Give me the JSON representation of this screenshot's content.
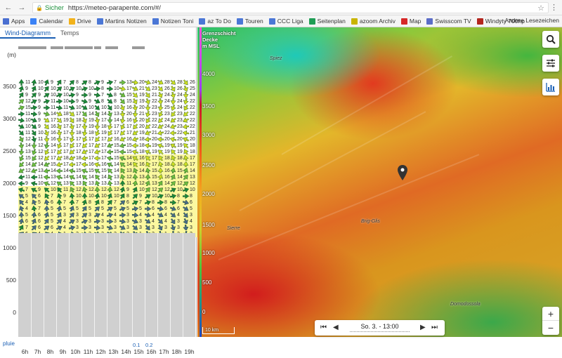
{
  "browser": {
    "secure_label": "Sicher",
    "url": "https://meteo-parapente.com/#/"
  },
  "bookmarks": [
    {
      "label": "Apps",
      "icon": "apps-grid-icon",
      "color": "#4a6fd1"
    },
    {
      "label": "Calendar",
      "icon": "calendar-icon",
      "color": "#3b82f6"
    },
    {
      "label": "Drive",
      "icon": "drive-icon",
      "color": "#f2b21b"
    },
    {
      "label": "Martins Notizen",
      "icon": "doc-icon",
      "color": "#4b77d6"
    },
    {
      "label": "Notizen Toni",
      "icon": "doc-icon",
      "color": "#4b77d6"
    },
    {
      "label": "az To Do",
      "icon": "doc-icon",
      "color": "#4b77d6"
    },
    {
      "label": "Touren",
      "icon": "doc-icon",
      "color": "#4b77d6"
    },
    {
      "label": "CCC Liga",
      "icon": "doc-icon",
      "color": "#4b77d6"
    },
    {
      "label": "Seitenplan",
      "icon": "sheet-icon",
      "color": "#1f9d55"
    },
    {
      "label": "azoom Archiv",
      "icon": "a2-icon",
      "color": "#c9b400"
    },
    {
      "label": "Map",
      "icon": "swiss-icon",
      "color": "#d62828"
    },
    {
      "label": "Swisscom TV",
      "icon": "swisscom-icon",
      "color": "#5b6dc8"
    },
    {
      "label": "Windyty 700hp",
      "icon": "windyty-icon",
      "color": "#b3261e"
    }
  ],
  "bookmarks_more": "Andere Lesezeichen",
  "tabs": [
    {
      "label": "Wind-Diagramm",
      "active": true
    },
    {
      "label": "Temps",
      "active": false
    }
  ],
  "diagram": {
    "unit": "(m)",
    "y_labels": [
      "3500",
      "3000",
      "2500",
      "2000",
      "1500",
      "1000",
      "500",
      "0"
    ],
    "hours": [
      "6h",
      "7h",
      "8h",
      "9h",
      "10h",
      "11h",
      "12h",
      "13h",
      "14h",
      "15h",
      "16h",
      "17h",
      "18h",
      "19h"
    ],
    "rain_label": "pluie",
    "rain": [
      {
        "hour_index": 9,
        "value": "0.1"
      },
      {
        "hour_index": 10,
        "value": "0.2"
      }
    ],
    "rows": [
      [
        "11",
        "10",
        "9",
        "7",
        "8",
        "8",
        "9",
        "7",
        "13",
        "20",
        "24",
        "28",
        "28",
        "26"
      ],
      [
        "9",
        "10",
        "10",
        "10",
        "10",
        "10",
        "8",
        "10",
        "17",
        "21",
        "23",
        "26",
        "26",
        "25"
      ],
      [
        "9",
        "9",
        "10",
        "10",
        "9",
        "9",
        "7",
        "8",
        "15",
        "19",
        "21",
        "24",
        "24",
        "24"
      ],
      [
        "12",
        "9",
        "11",
        "10",
        "9",
        "9",
        "8",
        "8",
        "15",
        "19",
        "22",
        "24",
        "24",
        "22"
      ],
      [
        "15",
        "9",
        "11",
        "11",
        "10",
        "10",
        "10",
        "10",
        "16",
        "20",
        "23",
        "25",
        "24",
        "22"
      ],
      [
        "11",
        "9",
        "14",
        "18",
        "17",
        "14",
        "14",
        "13",
        "20",
        "21",
        "23",
        "23",
        "23",
        "22"
      ],
      [
        "10",
        "9",
        "17",
        "19",
        "18",
        "19",
        "17",
        "14",
        "16",
        "20",
        "22",
        "24",
        "23",
        "22"
      ],
      [
        "10",
        "9",
        "16",
        "17",
        "17",
        "19",
        "18",
        "17",
        "17",
        "20",
        "22",
        "24",
        "23",
        "22"
      ],
      [
        "11",
        "10",
        "16",
        "17",
        "18",
        "18",
        "19",
        "17",
        "17",
        "19",
        "21",
        "22",
        "22",
        "21"
      ],
      [
        "12",
        "11",
        "16",
        "17",
        "17",
        "17",
        "17",
        "16",
        "16",
        "18",
        "20",
        "20",
        "20",
        "20"
      ],
      [
        "14",
        "12",
        "14",
        "17",
        "17",
        "17",
        "17",
        "15",
        "15",
        "18",
        "19",
        "19",
        "19",
        "18"
      ],
      [
        "13",
        "12",
        "17",
        "17",
        "17",
        "17",
        "17",
        "15",
        "15",
        "18",
        "19",
        "19",
        "19",
        "18"
      ],
      [
        "15",
        "12",
        "17",
        "18",
        "18",
        "17",
        "17",
        "15",
        "14",
        "16",
        "17",
        "18",
        "18",
        "17"
      ],
      [
        "14",
        "14",
        "15",
        "17",
        "17",
        "16",
        "16",
        "14",
        "14",
        "16",
        "17",
        "18",
        "18",
        "17"
      ],
      [
        "12",
        "13",
        "14",
        "14",
        "15",
        "15",
        "15",
        "14",
        "13",
        "14",
        "15",
        "16",
        "15",
        "14"
      ],
      [
        "11",
        "11",
        "13",
        "14",
        "14",
        "14",
        "14",
        "13",
        "12",
        "13",
        "15",
        "16",
        "14",
        "13"
      ],
      [
        "9",
        "10",
        "12",
        "13",
        "13",
        "13",
        "13",
        "13",
        "11",
        "12",
        "13",
        "14",
        "12",
        "12"
      ],
      [
        "7",
        "9",
        "10",
        "11",
        "12",
        "12",
        "12",
        "12",
        "9",
        "10",
        "12",
        "12",
        "10",
        "10"
      ],
      [
        "5",
        "6",
        "7",
        "9",
        "10",
        "10",
        "10",
        "10",
        "8",
        "9",
        "10",
        "10",
        "8",
        "8"
      ],
      [
        "4",
        "5",
        "6",
        "7",
        "7",
        "8",
        "8",
        "7",
        "6",
        "7",
        "8",
        "8",
        "7",
        "6"
      ],
      [
        "4",
        "7",
        "5",
        "5",
        "5",
        "5",
        "5",
        "5",
        "5",
        "5",
        "6",
        "6",
        "6",
        "5"
      ],
      [
        "5",
        "6",
        "5",
        "3",
        "3",
        "3",
        "4",
        "4",
        "3",
        "4",
        "4",
        "4",
        "4",
        "3"
      ],
      [
        "6",
        "6",
        "5",
        "4",
        "3",
        "3",
        "3",
        "3",
        "3",
        "3",
        "4",
        "4",
        "3",
        "4"
      ],
      [
        "7",
        "6",
        "6",
        "4",
        "3",
        "3",
        "3",
        "3",
        "3",
        "3",
        "3",
        "3",
        "3",
        "3"
      ],
      [
        "6",
        "4",
        "4",
        "1",
        "2",
        "2",
        "2",
        "2",
        "2",
        "1",
        "2",
        "1",
        "2",
        "2"
      ]
    ],
    "colors": {
      "green": "#1c8a3a",
      "lightgreen": "#6fbf3e",
      "yellow": "#cfe021",
      "yellowbg": "#fbf8a0",
      "gray": "#d0d0d0"
    }
  },
  "map": {
    "legend_title": [
      "Grenzschicht",
      "Decke",
      "m MSL"
    ],
    "scale_labels": [
      "4000",
      "3500",
      "3000",
      "2500",
      "2000",
      "1500",
      "1000",
      "500",
      "0"
    ],
    "places": [
      {
        "name": "Spiez"
      },
      {
        "name": "Sierre"
      },
      {
        "name": "Brig-Glis"
      },
      {
        "name": "Domodossola"
      }
    ],
    "scale_bar": "10 km",
    "time_label": "So. 3. - 13:00",
    "buttons": {
      "search_icon": "search-icon",
      "settings_icon": "sliders-icon",
      "chart_icon": "bar-chart-icon"
    },
    "zoom_in": "+",
    "zoom_out": "−",
    "colors": {
      "accent": "#1a5fb4"
    }
  }
}
